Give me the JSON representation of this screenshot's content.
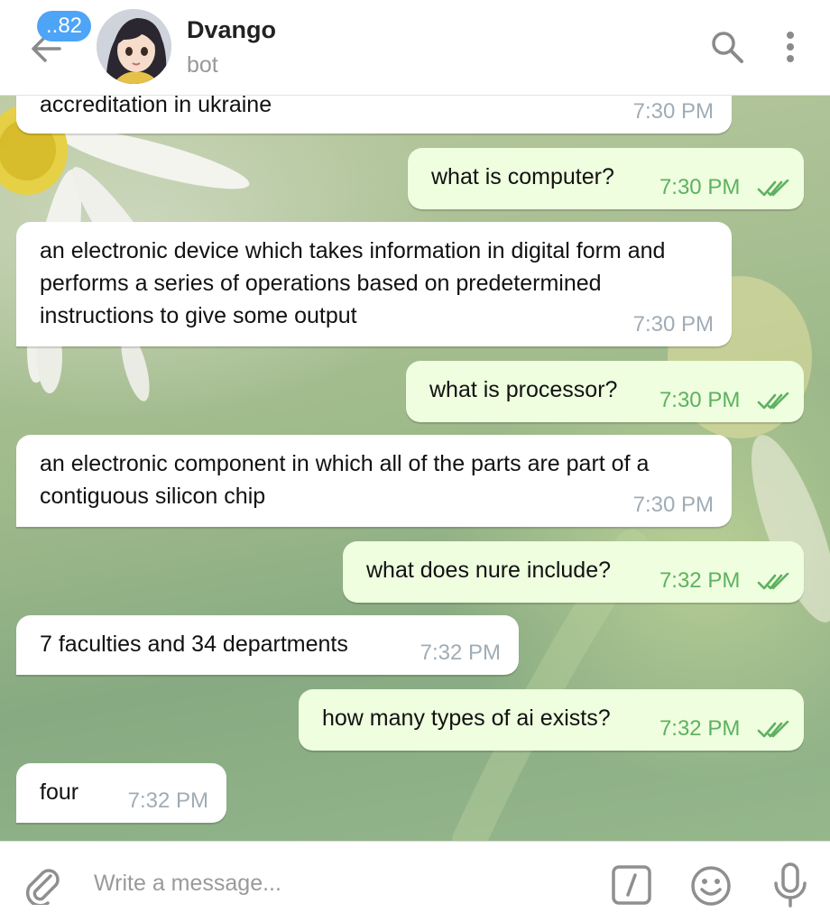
{
  "header": {
    "unread_count": "..82",
    "title": "Dvango",
    "status": "bot",
    "icons": [
      "back-arrow-icon",
      "avatar",
      "search-icon",
      "more-vertical-icon"
    ]
  },
  "messages": [
    {
      "direction": "in",
      "text": "accreditation in ukraine",
      "time": "7:30 PM"
    },
    {
      "direction": "out",
      "text": "what is computer?",
      "time": "7:30 PM",
      "status": "read"
    },
    {
      "direction": "in",
      "text": "an electronic device which takes information in digital form and performs a series of operations based on predetermined instructions to give some output",
      "time": "7:30 PM"
    },
    {
      "direction": "out",
      "text": "what is processor?",
      "time": "7:30 PM",
      "status": "read"
    },
    {
      "direction": "in",
      "text": "an electronic component in which all of the parts are part of a contiguous silicon chip",
      "time": "7:30 PM"
    },
    {
      "direction": "out",
      "text": "what does nure include?",
      "time": "7:32 PM",
      "status": "read"
    },
    {
      "direction": "in",
      "text": "7 faculties and 34 departments",
      "time": "7:32 PM"
    },
    {
      "direction": "out",
      "text": "how many types of ai exists?",
      "time": "7:32 PM",
      "status": "read"
    },
    {
      "direction": "in",
      "text": "four",
      "time": "7:32 PM"
    }
  ],
  "composer": {
    "placeholder": "Write a message...",
    "icons": [
      "attach-icon",
      "bot-commands-icon",
      "emoji-icon",
      "microphone-icon"
    ]
  },
  "colors": {
    "accent": "#4ea4f6",
    "outgoing_bubble": "#eefedf",
    "incoming_bubble": "#ffffff",
    "read_check": "#5eb15f",
    "incoming_time": "#a0acb6"
  }
}
